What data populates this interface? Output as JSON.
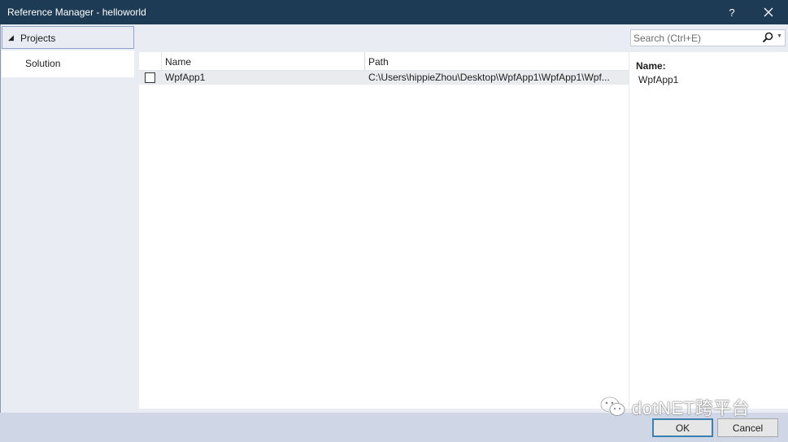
{
  "window": {
    "title": "Reference Manager - helloworld",
    "help_label": "?",
    "close_label": "✕"
  },
  "nav": {
    "projects_label": "Projects",
    "solution_label": "Solution"
  },
  "search": {
    "placeholder": "Search (Ctrl+E)",
    "value": ""
  },
  "list": {
    "columns": [
      "Name",
      "Path"
    ],
    "rows": [
      {
        "checked": false,
        "name": "WpfApp1",
        "path": "C:\\Users\\hippieZhou\\Desktop\\WpfApp1\\WpfApp1\\Wpf..."
      }
    ]
  },
  "detail": {
    "label": "Name:",
    "value": "WpfApp1"
  },
  "buttons": {
    "ok_label": "OK",
    "cancel_label": "Cancel"
  },
  "watermark": {
    "text": "dotNET跨平台"
  },
  "icons": [
    "help-icon",
    "close-icon",
    "expand-triangle-icon",
    "search-icon",
    "dropdown-arrow-icon",
    "wechat-icon"
  ],
  "colors": {
    "titlebar": "#1d3b54",
    "background": "#e9ecf3",
    "row_highlight": "#e9ebee",
    "ok_border": "#3c7fb1"
  }
}
